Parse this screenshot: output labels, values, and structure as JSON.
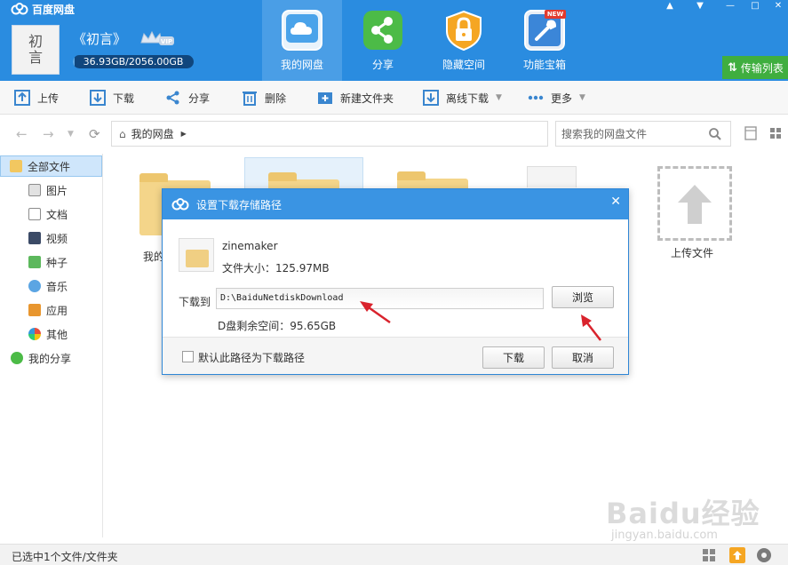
{
  "app": {
    "title": "百度网盘"
  },
  "user": {
    "avatar_text": "初\n言",
    "name": "《初言》",
    "vip": "VIP",
    "quota_text": "36.93GB/2056.00GB",
    "quota_fraction": 0.018
  },
  "window_controls": [
    "bell-icon",
    "menu-icon",
    "minimize-icon",
    "maximize-icon",
    "close-icon"
  ],
  "nav": {
    "tabs": [
      {
        "label": "我的网盘",
        "icon": "cloud-icon",
        "active": true
      },
      {
        "label": "分享",
        "icon": "share-icon",
        "active": false
      },
      {
        "label": "隐藏空间",
        "icon": "lock-icon",
        "active": false
      },
      {
        "label": "功能宝箱",
        "icon": "toolbox-icon",
        "active": false,
        "badge": "NEW"
      }
    ],
    "transfer_label": "传输列表"
  },
  "toolbar": {
    "upload": "上传",
    "download": "下载",
    "share": "分享",
    "delete": "删除",
    "new_folder": "新建文件夹",
    "offline_download": "离线下载",
    "more": "更多"
  },
  "address": {
    "breadcrumb": "我的网盘",
    "search_placeholder": "搜索我的网盘文件"
  },
  "sidebar": {
    "items": [
      {
        "label": "全部文件",
        "icon": "folder-icon"
      },
      {
        "label": "图片",
        "icon": "image-icon"
      },
      {
        "label": "文档",
        "icon": "document-icon"
      },
      {
        "label": "视频",
        "icon": "video-icon"
      },
      {
        "label": "种子",
        "icon": "torrent-icon"
      },
      {
        "label": "音乐",
        "icon": "music-icon"
      },
      {
        "label": "应用",
        "icon": "app-icon"
      },
      {
        "label": "其他",
        "icon": "other-icon"
      },
      {
        "label": "我的分享",
        "icon": "share-icon"
      }
    ]
  },
  "content": {
    "folder_label_partial": "我的",
    "upload_label": "上传文件"
  },
  "dialog": {
    "title": "设置下载存储路径",
    "file_name": "zinemaker",
    "file_size": "文件大小：125.97MB",
    "path_label": "下载到",
    "path_value": "D:\\BaiduNetdiskDownload",
    "browse_button": "浏览",
    "free_space": "D盘剩余空间：95.65GB",
    "default_checkbox_label": "默认此路径为下载路径",
    "download_button": "下载",
    "cancel_button": "取消"
  },
  "status": {
    "text": "已选中1个文件/文件夹"
  },
  "watermark": {
    "brand": "Baidu经验",
    "url": "jingyan.baidu.com"
  },
  "colors": {
    "header_blue": "#2a8ce0",
    "accent_red": "#d9232d",
    "transfer_green": "#3fae3f"
  }
}
